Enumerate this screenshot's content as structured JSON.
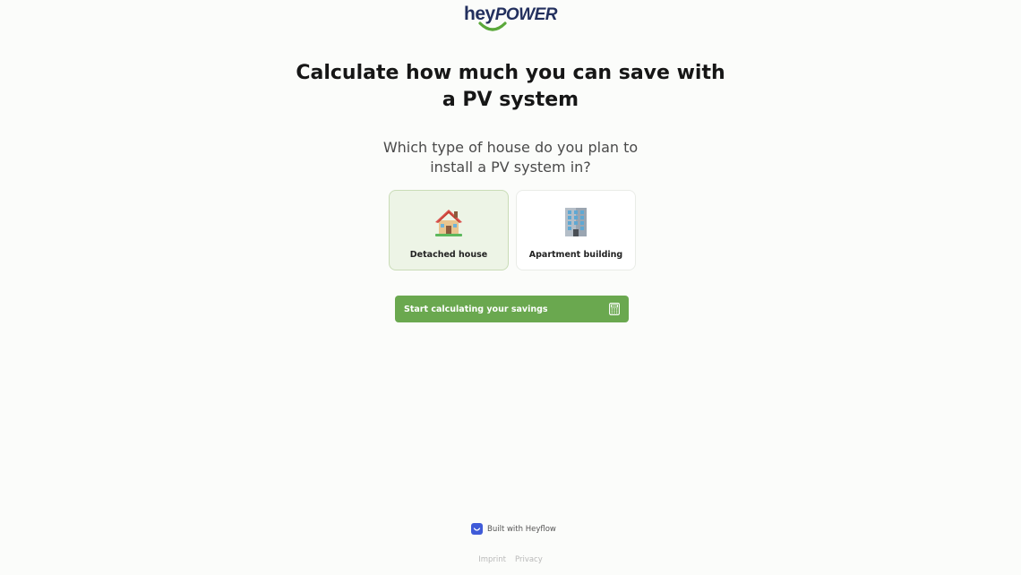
{
  "brand": {
    "logo_part1": "hey",
    "logo_part2": "POWER",
    "logo_color": "#23305e",
    "smile_color": "#5aa83a"
  },
  "headline": "Calculate how much you can save with a PV system",
  "question": "Which type of house do you plan to install a PV system in?",
  "options": [
    {
      "label": "Detached house",
      "icon": "house-icon",
      "selected": true
    },
    {
      "label": "Apartment building",
      "icon": "office-building-icon",
      "selected": false
    }
  ],
  "cta": {
    "label": "Start calculating your savings",
    "icon": "calculator-icon",
    "color": "#6aa84f"
  },
  "footer": {
    "built_with": "Built with Heyflow",
    "badge_color": "#3f5bd8",
    "links": [
      "Imprint",
      "Privacy"
    ]
  }
}
